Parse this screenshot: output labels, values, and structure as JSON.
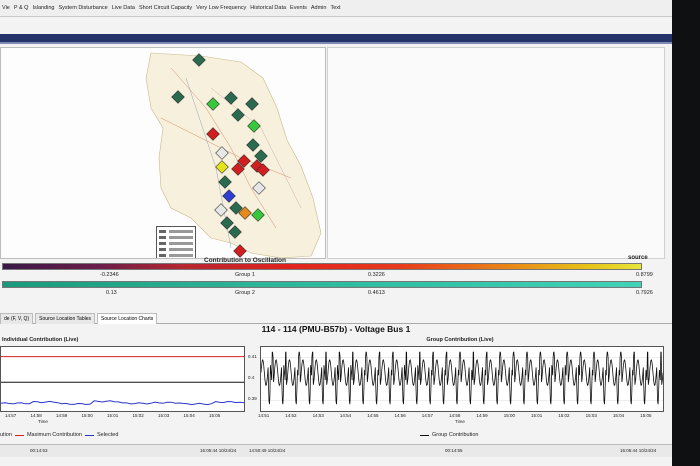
{
  "menu": {
    "items": [
      "Vie",
      "P & Q",
      "Islanding",
      "System Disturbance",
      "Live Data",
      "Short Circuit Capacity",
      "Very Low Frequency",
      "Historical Data",
      "Events",
      "Admin",
      "Text"
    ]
  },
  "map": {
    "markers": [
      {
        "color": "#2a6b4f"
      },
      {
        "color": "#2a6b4f"
      },
      {
        "color": "#38c63a"
      },
      {
        "color": "#2a6b4f"
      },
      {
        "color": "#2a6b4f"
      },
      {
        "color": "#2a6b4f"
      },
      {
        "color": "#d11f1f"
      },
      {
        "color": "#38c63a"
      },
      {
        "color": "#2a6b4f"
      },
      {
        "color": "#e7e7e7"
      },
      {
        "color": "#d11f1f"
      },
      {
        "color": "#2a6b4f"
      },
      {
        "color": "#e4e21a"
      },
      {
        "color": "#d11f1f"
      },
      {
        "color": "#d11f1f"
      },
      {
        "color": "#d11f1f"
      },
      {
        "color": "#e7e7e7"
      },
      {
        "color": "#2a6b4f"
      },
      {
        "color": "#2d3fd1"
      },
      {
        "color": "#e7e7e7"
      },
      {
        "color": "#2a6b4f"
      },
      {
        "color": "#2a6b4f"
      },
      {
        "color": "#e48a1a"
      },
      {
        "color": "#38c63a"
      },
      {
        "color": "#2a6b4f"
      },
      {
        "color": "#d11f1f"
      }
    ]
  },
  "contribution": {
    "title": "Contribution to Oscillation",
    "source_label": "source",
    "group1": {
      "name": "Group 1",
      "min": "-0.2346",
      "mid": "0.3226",
      "max": "0.8799"
    },
    "group2": {
      "name": "Group 2",
      "min": "0.13",
      "mid": "0.4613",
      "max": "0.7926"
    }
  },
  "tabs": [
    {
      "label": "de (F, V, Q)"
    },
    {
      "label": "Source Location Tables"
    },
    {
      "label": "Source Location Charts"
    }
  ],
  "chart_title": "114 - 114 (PMU-B57b) - Voltage Bus 1",
  "chart_data": [
    {
      "type": "line",
      "title": "Individual Contribution (Live)",
      "xlabel": "Time",
      "categories": [
        "14:57",
        "14:58",
        "14:59",
        "15:00",
        "15:01",
        "15:02",
        "15:03",
        "15:04",
        "15:05"
      ],
      "series": [
        {
          "name": "Maximum Contribution",
          "color": "#d62020",
          "values": [
            0.85,
            0.85,
            0.85,
            0.85,
            0.85,
            0.85,
            0.85,
            0.85,
            0.85
          ]
        },
        {
          "name": "Contribution",
          "color": "#111111",
          "values": [
            0.45,
            0.45,
            0.45,
            0.45,
            0.45,
            0.45,
            0.45,
            0.45,
            0.45
          ]
        },
        {
          "name": "Selected",
          "color": "#2a35c8",
          "values": [
            0.12,
            0.14,
            0.11,
            0.15,
            0.12,
            0.13,
            0.11,
            0.14,
            0.12
          ]
        }
      ],
      "legend": "bottom",
      "status_left": "00:14:53",
      "status_right": "15:05:44 10/24/24"
    },
    {
      "type": "line",
      "title": "Group Contribution (Live)",
      "xlabel": "Time",
      "categories": [
        "14:51",
        "14:52",
        "14:53",
        "14:54",
        "14:55",
        "14:56",
        "14:57",
        "14:58",
        "14:59",
        "15:00",
        "15:01",
        "15:02",
        "15:03",
        "15:04",
        "15:05"
      ],
      "yticks": [
        "0.41",
        "0.4",
        "0.39"
      ],
      "ylim": [
        0.385,
        0.415
      ],
      "series": [
        {
          "name": "Group Contribution",
          "color": "#111111",
          "cycles": 30
        }
      ],
      "legend": "bottom",
      "status_left": "14:50:49 10/24/24",
      "status_mid": "00:14:55",
      "status_right": "15:05:44 10/24/24"
    }
  ]
}
